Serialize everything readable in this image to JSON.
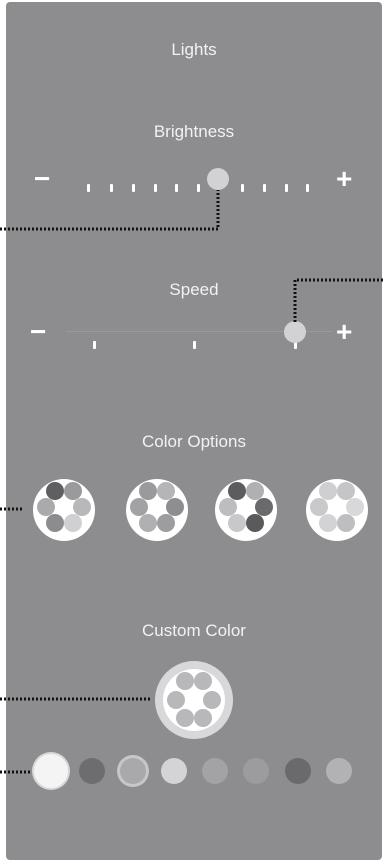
{
  "panel": {
    "title": "Lights"
  },
  "brightness": {
    "label": "Brightness",
    "minus": "−",
    "plus": "+",
    "value_fraction": 0.5
  },
  "speed": {
    "label": "Speed",
    "minus": "−",
    "plus": "+",
    "value_fraction": 0.82
  },
  "color_options": {
    "label": "Color Options",
    "presets": [
      {
        "dots": [
          "#5f5f61",
          "#9a9a9c",
          "#b8b8ba",
          "#d0d0d2",
          "#8c8c8e",
          "#aaaaac"
        ]
      },
      {
        "dots": [
          "#9a9a9c",
          "#b5b5b7",
          "#8e8e90",
          "#9d9d9f",
          "#b0b0b2",
          "#a2a2a4"
        ]
      },
      {
        "dots": [
          "#5c5c5e",
          "#b0b0b2",
          "#6a6a6c",
          "#5a5a5c",
          "#c8c8ca",
          "#bdbdbf"
        ]
      },
      {
        "dots": [
          "#cfcfd1",
          "#c5c5c7",
          "#d8d8da",
          "#bebec0",
          "#d3d3d5",
          "#c9c9cb"
        ]
      }
    ]
  },
  "custom_color": {
    "label": "Custom Color",
    "swatches": [
      {
        "color": "#f4f4f4",
        "selected": true
      },
      {
        "color": "#6d6d6f",
        "selected": false
      },
      {
        "color": "#a9a9ab",
        "selected": false
      },
      {
        "color": "#d4d4d6",
        "selected": false
      },
      {
        "color": "#a3a3a5",
        "selected": false
      },
      {
        "color": "#9c9c9e",
        "selected": false
      },
      {
        "color": "#6a6a6c",
        "selected": false
      },
      {
        "color": "#b2b2b4",
        "selected": false
      }
    ]
  }
}
